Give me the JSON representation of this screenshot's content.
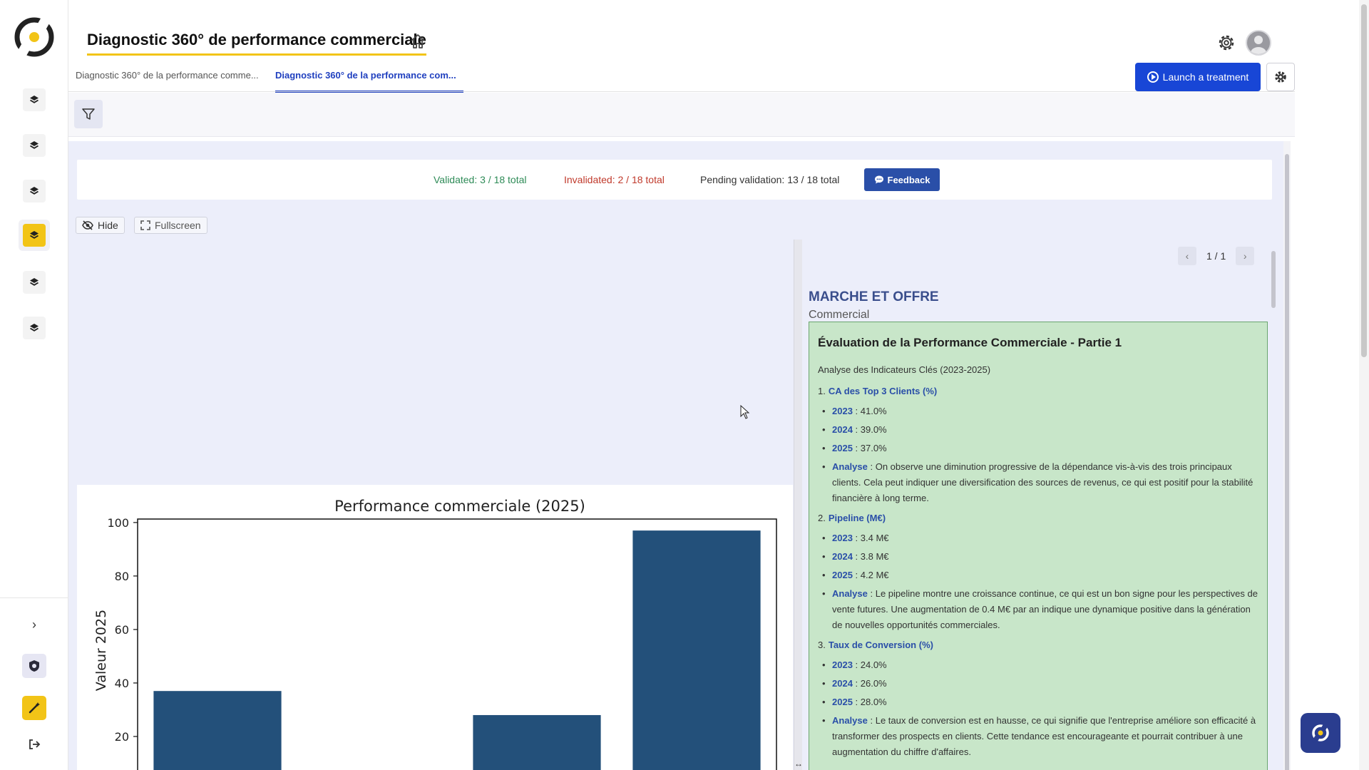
{
  "header": {
    "title": "Diagnostic 360° de performance commerciale"
  },
  "tabs": [
    {
      "label": "Diagnostic 360° de la performance comme..."
    },
    {
      "label": "Diagnostic 360° de la performance com..."
    }
  ],
  "toolbar": {
    "launch_label": "Launch a treatment"
  },
  "validation": {
    "validated": "Validated: 3 / 18 total",
    "invalidated": "Invalidated: 2 / 18 total",
    "pending": "Pending validation: 13 / 18 total",
    "feedback_label": "Feedback"
  },
  "view_controls": {
    "hide_label": "Hide",
    "fullscreen_label": "Fullscreen"
  },
  "pager": {
    "text": "1 / 1"
  },
  "panel": {
    "section_title": "MARCHE ET OFFRE",
    "section_subtitle": "Commercial",
    "report_title": "Évaluation de la Performance Commerciale - Partie 1",
    "intro": "Analyse des Indicateurs Clés (2023-2025)",
    "indicators": [
      {
        "num": "1.",
        "title": "CA des Top 3 Clients (%)",
        "y2023_key": "2023",
        "y2023_val": " : 41.0%",
        "y2024_key": "2024",
        "y2024_val": " : 39.0%",
        "y2025_key": "2025",
        "y2025_val": " : 37.0%",
        "analysis_key": "Analyse",
        "analysis": " : On observe une diminution progressive de la dépendance vis-à-vis des trois principaux clients. Cela peut indiquer une diversification des sources de revenus, ce qui est positif pour la stabilité financière à long terme."
      },
      {
        "num": "2.",
        "title": "Pipeline (M€)",
        "y2023_key": "2023",
        "y2023_val": " : 3.4 M€",
        "y2024_key": "2024",
        "y2024_val": " : 3.8 M€",
        "y2025_key": "2025",
        "y2025_val": " : 4.2 M€",
        "analysis_key": "Analyse",
        "analysis": " : Le pipeline montre une croissance continue, ce qui est un bon signe pour les perspectives de vente futures. Une augmentation de 0.4 M€ par an indique une dynamique positive dans la génération de nouvelles opportunités commerciales."
      },
      {
        "num": "3.",
        "title": "Taux de Conversion (%)",
        "y2023_key": "2023",
        "y2023_val": " : 24.0%",
        "y2024_key": "2024",
        "y2024_val": " : 26.0%",
        "y2025_key": "2025",
        "y2025_val": " : 28.0%",
        "analysis_key": "Analyse",
        "analysis": " : Le taux de conversion est en hausse, ce qui signifie que l'entreprise améliore son efficacité à transformer des prospects en clients. Cette tendance est encourageante et pourrait contribuer à une augmentation du chiffre d'affaires."
      }
    ]
  },
  "sidebar": {
    "items": [
      {
        "icon": "layers-icon",
        "active": false
      },
      {
        "icon": "layers-icon",
        "active": false
      },
      {
        "icon": "layers-icon",
        "active": false
      },
      {
        "icon": "layers-icon",
        "active": true
      },
      {
        "icon": "layers-icon",
        "active": false
      },
      {
        "icon": "layers-icon",
        "active": false
      }
    ],
    "expand_glyph": "›"
  },
  "colors": {
    "accent_yellow": "#f2c417",
    "primary_blue": "#1846d6",
    "bar_color": "#23507a",
    "report_bg": "#c8e6c9"
  },
  "chart_data": {
    "type": "bar",
    "title": "Performance commerciale (2025)",
    "xlabel": "",
    "ylabel": "Valeur 2025",
    "yticks": [
      20,
      40,
      60,
      80,
      100
    ],
    "values": [
      37,
      0.4,
      28,
      97
    ],
    "ylim": [
      0,
      100
    ]
  }
}
